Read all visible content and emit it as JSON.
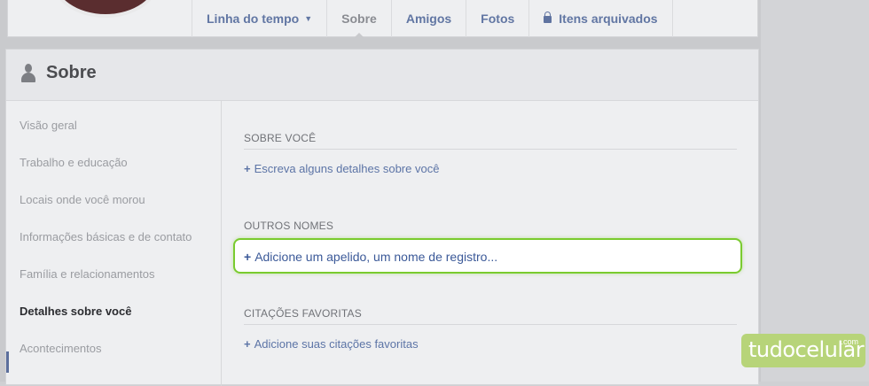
{
  "profile_nav": {
    "tabs": [
      {
        "label": "Linha do tempo"
      },
      {
        "label": "Sobre"
      },
      {
        "label": "Amigos"
      },
      {
        "label": "Fotos"
      },
      {
        "label": "Itens arquivados"
      }
    ]
  },
  "about": {
    "title": "Sobre",
    "sidebar": [
      {
        "label": "Visão geral"
      },
      {
        "label": "Trabalho e educação"
      },
      {
        "label": "Locais onde você morou"
      },
      {
        "label": "Informações básicas e de contato"
      },
      {
        "label": "Família e relacionamentos"
      },
      {
        "label": "Detalhes sobre você"
      },
      {
        "label": "Acontecimentos"
      }
    ],
    "active_item": "Detalhes sobre você",
    "sections": [
      {
        "label": "SOBRE VOCÊ",
        "link": "Escreva alguns detalhes sobre você"
      },
      {
        "label": "OUTROS NOMES",
        "link": "Adicione um apelido, um nome de registro..."
      },
      {
        "label": "CITAÇÕES FAVORITAS",
        "link": "Adicione suas citações favoritas"
      }
    ],
    "plus": "+"
  },
  "watermark": {
    "brand": "tudocelular",
    "suffix": ".com"
  },
  "colors": {
    "highlight": "#7acb2f",
    "link": "#3b5998",
    "accent": "#5c6f9c"
  }
}
